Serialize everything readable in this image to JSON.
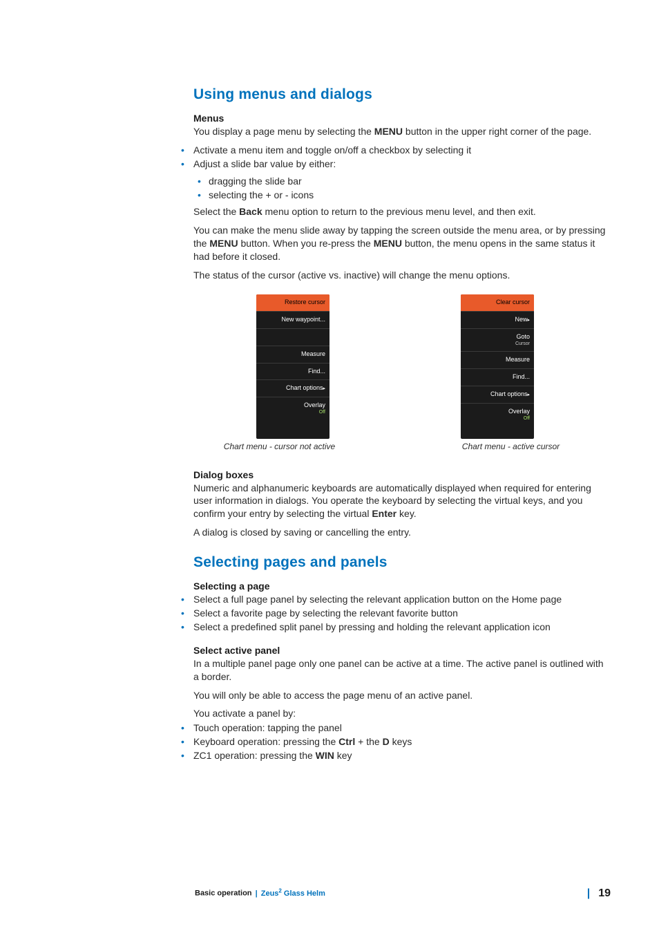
{
  "section1": {
    "title": "Using menus and dialogs",
    "menus": {
      "heading": "Menus",
      "p1a": "You display a page menu by selecting the ",
      "p1b": "MENU",
      "p1c": " button in the upper right corner of the page.",
      "b1": "Activate a menu item and toggle on/off a checkbox by selecting it",
      "b2": "Adjust a slide bar value by either:",
      "b2a": "dragging the slide bar",
      "b2b": "selecting the + or - icons",
      "p2a": "Select the ",
      "p2b": "Back",
      "p2c": " menu option to return to the previous menu level, and then exit.",
      "p3a": "You can make the menu slide away by tapping the screen outside the menu area, or by pressing the ",
      "p3b": "MENU",
      "p3c": " button. When you re-press the ",
      "p3d": "MENU",
      "p3e": " button, the menu opens in the same status it had before it closed.",
      "p4": "The status of the cursor (active vs. inactive) will change the menu options."
    },
    "menuLeft": {
      "i0": "Restore cursor",
      "i1": "New waypoint...",
      "i2": "Measure",
      "i3": "Find...",
      "i4": "Chart options",
      "i5": "Overlay",
      "i5s": "Off"
    },
    "menuRight": {
      "i0": "Clear cursor",
      "i1": "New",
      "i2": "Goto",
      "i2s": "Cursor",
      "i3": "Measure",
      "i4": "Find...",
      "i5": "Chart options",
      "i6": "Overlay",
      "i6s": "Off"
    },
    "cap1": "Chart menu - cursor not active",
    "cap2": "Chart menu - active cursor",
    "dialog": {
      "heading": "Dialog boxes",
      "p1a": "Numeric and alphanumeric keyboards are automatically displayed when required for entering user information in dialogs. You operate the keyboard by selecting the virtual keys, and you confirm your entry by selecting the virtual ",
      "p1b": "Enter",
      "p1c": " key.",
      "p2": "A dialog is closed by saving or cancelling the entry."
    }
  },
  "section2": {
    "title": "Selecting pages and panels",
    "selpage": {
      "heading": "Selecting a page",
      "b1": "Select a full page panel by selecting the relevant application button on the Home page",
      "b2": "Select a favorite page by selecting the relevant favorite button",
      "b3": "Select a predefined split panel by pressing and holding the relevant application icon"
    },
    "selactive": {
      "heading": "Select active panel",
      "p1": "In a multiple panel page only one panel can be active at a time. The active panel is outlined with a border.",
      "p2": "You will only be able to access the page menu of an active panel.",
      "p3": "You activate a panel by:",
      "b1": "Touch operation: tapping the panel",
      "b2a": "Keyboard operation: pressing the ",
      "b2b": "Ctrl",
      "b2c": " + the ",
      "b2d": "D",
      "b2e": " keys",
      "b3a": "ZC1 operation: pressing the ",
      "b3b": "WIN",
      "b3c": " key"
    }
  },
  "footer": {
    "chapter": "Basic operation",
    "sep": "|",
    "book_a": "Zeus",
    "book_sup": "2",
    "book_b": " Glass Helm",
    "page": "19"
  }
}
